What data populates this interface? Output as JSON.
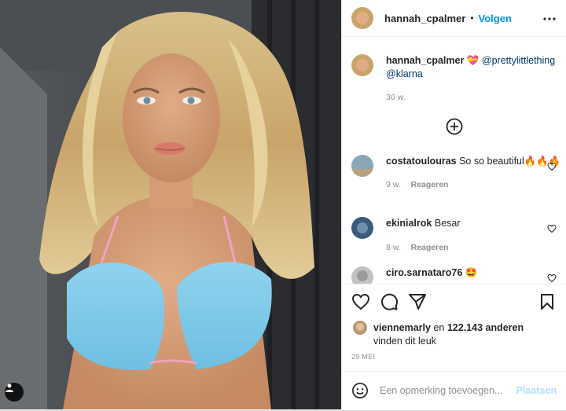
{
  "post": {
    "username": "hannah_cpalmer",
    "separator": "•",
    "follow_label": "Volgen",
    "caption": {
      "username": "hannah_cpalmer",
      "mention1": "@prettylittlething",
      "mention2": "@klarna",
      "time": "30 w."
    },
    "comments": [
      {
        "username": "costatoulouras",
        "text": "So so beautiful🔥🔥🔥",
        "time": "9 w.",
        "reply_label": "Reageren"
      },
      {
        "username": "ekinialrok",
        "text": "Besar",
        "time": "8 w.",
        "reply_label": "Reageren"
      },
      {
        "username": "ciro.sarnataro76",
        "text": "🤩",
        "time": "",
        "reply_label": ""
      }
    ],
    "likes": {
      "user": "viennemarly",
      "connector": "en",
      "count": "122.143 anderen",
      "suffix": "vinden dit leuk"
    },
    "date": "29 MEI",
    "composer": {
      "placeholder": "Een opmerking toevoegen...",
      "post_label": "Plaatsen"
    }
  },
  "icons": {
    "more": "more-horizontal-icon",
    "load_more": "plus-circle-icon",
    "like": "heart-icon",
    "comment": "comment-icon",
    "share": "share-icon",
    "save": "bookmark-icon",
    "emoji": "emoji-icon",
    "tag": "user-tag-icon"
  },
  "colors": {
    "accent": "#0095f6",
    "post_disabled": "#b2dffc",
    "muted": "#8e8e8e",
    "bikini": "#7ec8e8"
  }
}
